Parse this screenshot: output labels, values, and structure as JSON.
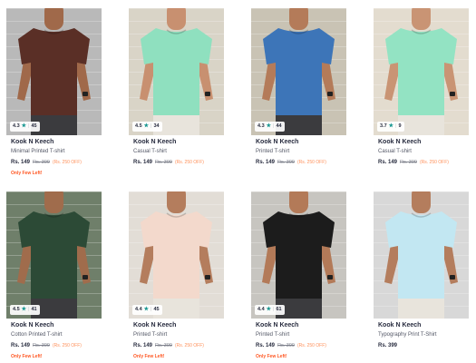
{
  "products": [
    {
      "brand": "Kook N Keech",
      "title": "Minimal Printed T-shirt",
      "price": "Rs. 149",
      "mrp": "Rs. 399",
      "discount": "(Rs. 250 OFF)",
      "stock_note": "Only Few Left!",
      "rating": "4.3",
      "rating_count": "45",
      "shirt_color": "#5a2f26",
      "bg_color": "#b9b9b9",
      "skin": "#a0694a"
    },
    {
      "brand": "Kook N Keech",
      "title": "Casual T-shirt",
      "price": "Rs. 149",
      "mrp": "Rs. 399",
      "discount": "(Rs. 250 OFF)",
      "stock_note": "",
      "rating": "4.5",
      "rating_count": "34",
      "shirt_color": "#8fe0bf",
      "bg_color": "#d9d4c7",
      "skin": "#c89070"
    },
    {
      "brand": "Kook N Keech",
      "title": "Printed T-shirt",
      "price": "Rs. 149",
      "mrp": "Rs. 399",
      "discount": "(Rs. 250 OFF)",
      "stock_note": "",
      "rating": "4.3",
      "rating_count": "44",
      "shirt_color": "#3d75b8",
      "bg_color": "#c9c3b4",
      "skin": "#b47b59"
    },
    {
      "brand": "Kook N Keech",
      "title": "Casual T-shirt",
      "price": "Rs. 149",
      "mrp": "Rs. 399",
      "discount": "(Rs. 250 OFF)",
      "stock_note": "",
      "rating": "3.7",
      "rating_count": "9",
      "shirt_color": "#93e3c3",
      "bg_color": "#e3dccf",
      "skin": "#c99474"
    },
    {
      "brand": "Kook N Keech",
      "title": "Cotton Printed T-shirt",
      "price": "Rs. 149",
      "mrp": "Rs. 399",
      "discount": "(Rs. 250 OFF)",
      "stock_note": "Only Few Left!",
      "rating": "4.5",
      "rating_count": "41",
      "shirt_color": "#2c4a36",
      "bg_color": "#6f7f6a",
      "skin": "#a06c4c"
    },
    {
      "brand": "Kook N Keech",
      "title": "Printed T-shirt",
      "price": "Rs. 149",
      "mrp": "Rs. 399",
      "discount": "(Rs. 250 OFF)",
      "stock_note": "Only Few Left!",
      "rating": "4.4",
      "rating_count": "45",
      "shirt_color": "#f3d9cc",
      "bg_color": "#e2ddd6",
      "skin": "#b47d5d"
    },
    {
      "brand": "Kook N Keech",
      "title": "Printed T-shirt",
      "price": "Rs. 149",
      "mrp": "Rs. 399",
      "discount": "(Rs. 250 OFF)",
      "stock_note": "Only Few Left!",
      "rating": "4.4",
      "rating_count": "61",
      "shirt_color": "#1c1c1c",
      "bg_color": "#c7c5c0",
      "skin": "#b37a58"
    },
    {
      "brand": "Kook N Keech",
      "title": "Typography Print T-Shirt",
      "price": "Rs. 399",
      "mrp": "",
      "discount": "",
      "stock_note": "",
      "rating": "",
      "rating_count": "",
      "shirt_color": "#c2e7f2",
      "bg_color": "#d8d8d8",
      "skin": "#b47d5d"
    }
  ]
}
